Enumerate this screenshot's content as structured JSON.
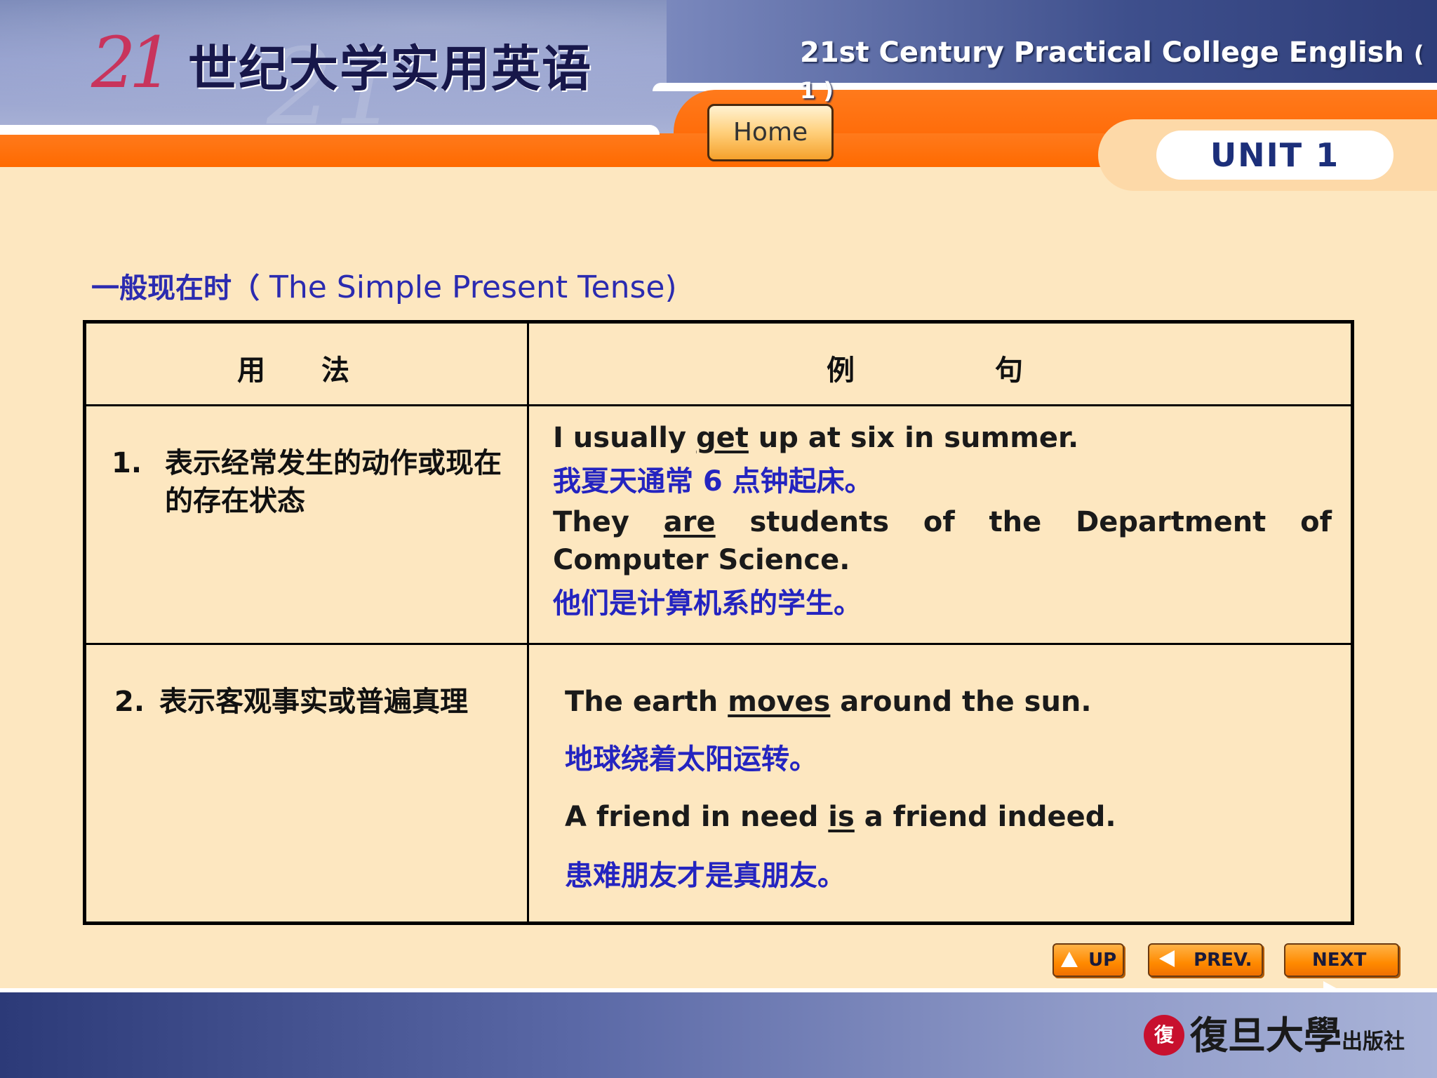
{
  "header": {
    "logo_number": "21",
    "cn_title": "世纪大学实用英语",
    "en_title": "21st Century Practical College English",
    "en_title_suffix": "( 1 )",
    "home_label": "Home",
    "unit_label": "UNIT 1"
  },
  "section": {
    "title_cn": "一般现在时（",
    "title_en": " The Simple Present Tense",
    "title_close": ")"
  },
  "table": {
    "headers": {
      "usage": "用　　法",
      "examples": "例　　　　　句"
    },
    "rows": [
      {
        "num": "1.",
        "usage": "表示经常发生的动作或现在的存在状态",
        "examples": [
          {
            "en_before": "I usually ",
            "en_verb": "get",
            "en_after": " up at six in summer.",
            "cn": "我夏天通常 6 点钟起床。"
          },
          {
            "en_before": "They ",
            "en_verb": "are",
            "en_after": " students of the Department of Computer Science.",
            "cn": "他们是计算机系的学生。"
          }
        ]
      },
      {
        "num": "2.",
        "usage": "表示客观事实或普遍真理",
        "examples": [
          {
            "en_before": "The earth ",
            "en_verb": "moves",
            "en_after": " around the sun.",
            "cn": "地球绕着太阳运转。"
          },
          {
            "en_before": "A friend in need ",
            "en_verb": "is",
            "en_after": " a friend indeed.",
            "cn": "患难朋友才是真朋友。"
          }
        ]
      }
    ]
  },
  "nav": {
    "up": "UP",
    "prev": "PREV.",
    "next": "NEXT"
  },
  "footer": {
    "publisher": "復旦大學",
    "publisher_suffix": "出版社",
    "seal_text": "復"
  },
  "colors": {
    "orange": "#ff6a00",
    "navy": "#2c3a78",
    "cn_blue": "#2424c0",
    "background": "#fde7c0"
  }
}
